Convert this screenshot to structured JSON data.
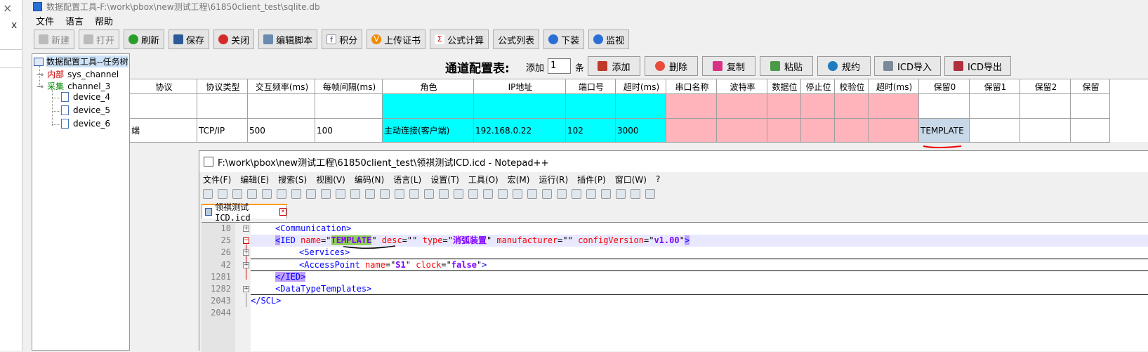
{
  "left_strip": {
    "close_glyph": "×",
    "x_glyph": "x"
  },
  "app": {
    "title": "数据配置工具-F:\\work\\pbox\\new测试工程\\61850client_test\\sqlite.db",
    "menu": [
      "文件",
      "语言",
      "帮助"
    ],
    "toolbar": {
      "new": "新建",
      "open": "打开",
      "refresh": "刷新",
      "save": "保存",
      "close": "关闭",
      "edit_script": "编辑脚本",
      "integral": "积分",
      "upload_cert": "上传证书",
      "formula_calc": "公式计算",
      "formula_list": "公式列表",
      "download": "下装",
      "monitor": "监视"
    },
    "tree": {
      "root": "数据配置工具--任务树",
      "internal": {
        "tag": "内部",
        "name": "sys_channel"
      },
      "collect": {
        "tag": "采集",
        "name": "channel_3"
      },
      "devices": [
        "device_4",
        "device_5",
        "device_6"
      ]
    },
    "channel": {
      "title": "通道配置表:",
      "add_prefix": "添加",
      "count": "1",
      "unit": "条",
      "buttons": {
        "add": "添加",
        "delete": "删除",
        "copy": "复制",
        "paste": "粘贴",
        "spec": "规约",
        "icd_import": "ICD导入",
        "icd_export": "ICD导出"
      }
    },
    "grid": {
      "headers": [
        "协议",
        "协议类型",
        "交互频率(ms)",
        "每帧间隔(ms)",
        "角色",
        "IP地址",
        "端口号",
        "超时(ms)",
        "串口名称",
        "波特率",
        "数据位",
        "停止位",
        "校验位",
        "超时(ms)",
        "保留0",
        "保留1",
        "保留2",
        "保留"
      ],
      "row": [
        "端",
        "TCP/IP",
        "500",
        "100",
        "主动连接(客户端)",
        "192.168.0.22",
        "102",
        "3000",
        "",
        "",
        "",
        "",
        "",
        "",
        "TEMPLATE",
        "",
        "",
        ""
      ]
    }
  },
  "npp": {
    "title": "F:\\work\\pbox\\new测试工程\\61850client_test\\领祺测试ICD.icd - Notepad++",
    "menu": [
      "文件(F)",
      "编辑(E)",
      "搜索(S)",
      "视图(V)",
      "编码(N)",
      "语言(L)",
      "设置(T)",
      "工具(O)",
      "宏(M)",
      "运行(R)",
      "插件(P)",
      "窗口(W)",
      "?"
    ],
    "tab": "领祺测试ICD.icd",
    "line_numbers": [
      "10",
      "25",
      "26",
      "42",
      "1281",
      "1282",
      "2043",
      "2044"
    ],
    "code": {
      "l10": "<Communication>",
      "l25": {
        "open": "<",
        "tag": "IED",
        "name_attr": "name",
        "eq": "=\"",
        "name_val": "TEMPLATE",
        "q": "\"",
        "desc_attr": "desc",
        "empty": "=\"\"",
        "type_attr": "type",
        "type_val": "消弧装置",
        "manu_attr": "manufacturer",
        "cfg_attr": "configVersion",
        "cfg_val": "v1.00",
        "close": ">"
      },
      "l26": "<Services>",
      "l42": {
        "tag": "<AccessPoint",
        "name_attr": "name",
        "name_val": "S1",
        "clock_attr": "clock",
        "clock_val": "false",
        "end": ">"
      },
      "l1281": "</IED>",
      "l1282": "<DataTypeTemplates>",
      "l2043": "</SCL>"
    }
  },
  "colors": {
    "cyan": "#00ffff",
    "pink": "#ffb3ba",
    "tag": "#0000ff",
    "attr": "#ff0000",
    "value": "#8000ff"
  }
}
